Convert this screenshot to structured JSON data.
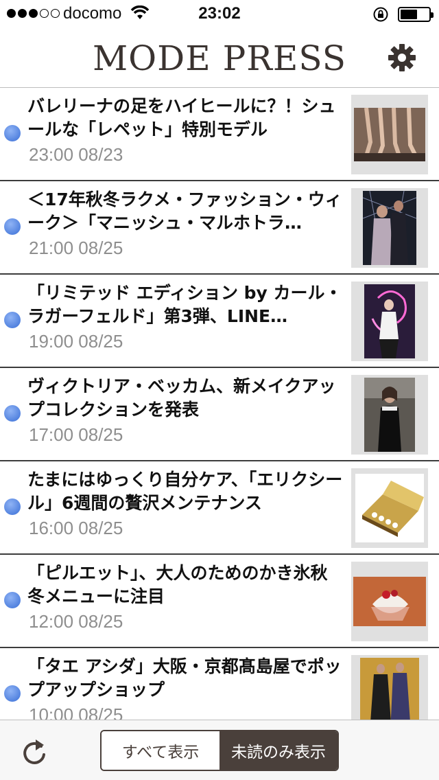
{
  "status_bar": {
    "carrier": "docomo",
    "time": "23:02"
  },
  "header": {
    "logo": "MODE PRESS",
    "settings_icon": "gear-icon"
  },
  "articles": [
    {
      "title": "バレリーナの足をハイヒールに？！シュールな「レペット」特別モデル",
      "time": "23:00 08/23"
    },
    {
      "title": "＜17年秋冬ラクメ・ファッション・ウィーク＞「マニッシュ・マルホトラ…",
      "time": "21:00 08/25"
    },
    {
      "title": "「リミテッド エディション by カール・ラガーフェルド」第3弾、LINE…",
      "time": "19:00 08/25"
    },
    {
      "title": "ヴィクトリア・ベッカム、新メイクアップコレクションを発表",
      "time": "17:00 08/25"
    },
    {
      "title": "たまにはゆっくり自分ケア、「エリクシール」6週間の贅沢メンテナンス",
      "time": "16:00 08/25"
    },
    {
      "title": "「ピルエット」、大人のためのかき氷秋冬メニューに注目",
      "time": "12:00 08/25"
    },
    {
      "title": "「タエ アシダ」大阪・京都髙島屋でポップアップショップ",
      "time": "10:00 08/25"
    }
  ],
  "toolbar": {
    "refresh_icon": "refresh-icon",
    "show_all": "すべて表示",
    "show_unread": "未読のみ表示"
  },
  "colors": {
    "unread_dot": "#4a7ce0",
    "accent": "#4a403b"
  }
}
